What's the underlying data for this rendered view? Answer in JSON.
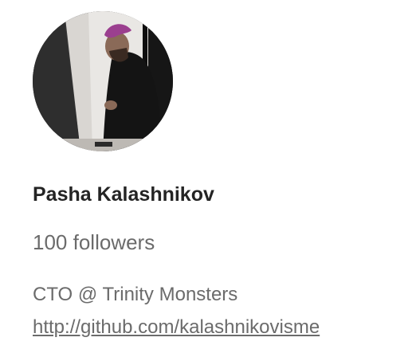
{
  "profile": {
    "avatar_icon": "user-avatar-photo",
    "name": "Pasha Kalashnikov",
    "followers": "100 followers",
    "bio": "CTO @ Trinity Monsters",
    "link": "http://github.com/kalashnikovisme"
  },
  "colors": {
    "name_text": "#242424",
    "secondary_text": "#6b6b6b",
    "background": "#ffffff"
  }
}
